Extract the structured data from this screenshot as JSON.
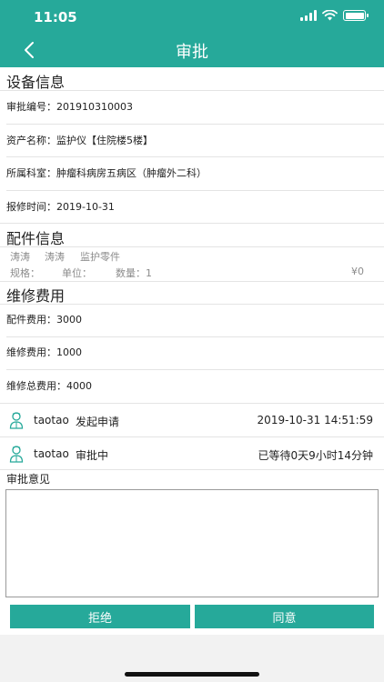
{
  "status": {
    "time": "11:05"
  },
  "nav": {
    "title": "审批"
  },
  "device": {
    "title": "设备信息",
    "approval_no_label": "审批编号：",
    "approval_no": "201910310003",
    "asset_label": "资产名称：",
    "asset": "监护仪【住院楼5楼】",
    "dept_label": "所属科室：",
    "dept": "肿瘤科病房五病区（肿瘤外二科）",
    "report_label": "报修时间：",
    "report_time": "2019-10-31"
  },
  "parts": {
    "title": "配件信息",
    "item": {
      "name1": "涛涛",
      "name2": "涛涛",
      "name3": "监护零件"
    },
    "spec_label": "规格：",
    "unit_label": "单位：",
    "qty_label": "数量：",
    "qty": "1",
    "price": "¥0"
  },
  "cost": {
    "title": "维修费用",
    "parts_label": "配件费用：",
    "parts_fee": "3000",
    "repair_label": "维修费用：",
    "repair_fee": "1000",
    "total_label": "维修总费用：",
    "total_fee": "4000"
  },
  "flow": [
    {
      "user": "taotao",
      "action": "发起申请",
      "right": "2019-10-31 14:51:59"
    },
    {
      "user": "taotao",
      "action": "审批中",
      "right": "已等待0天9小时14分钟"
    }
  ],
  "opinion": {
    "label": "审批意见",
    "placeholder": ""
  },
  "buttons": {
    "reject": "拒绝",
    "approve": "同意"
  },
  "colors": {
    "accent": "#26a99a"
  }
}
